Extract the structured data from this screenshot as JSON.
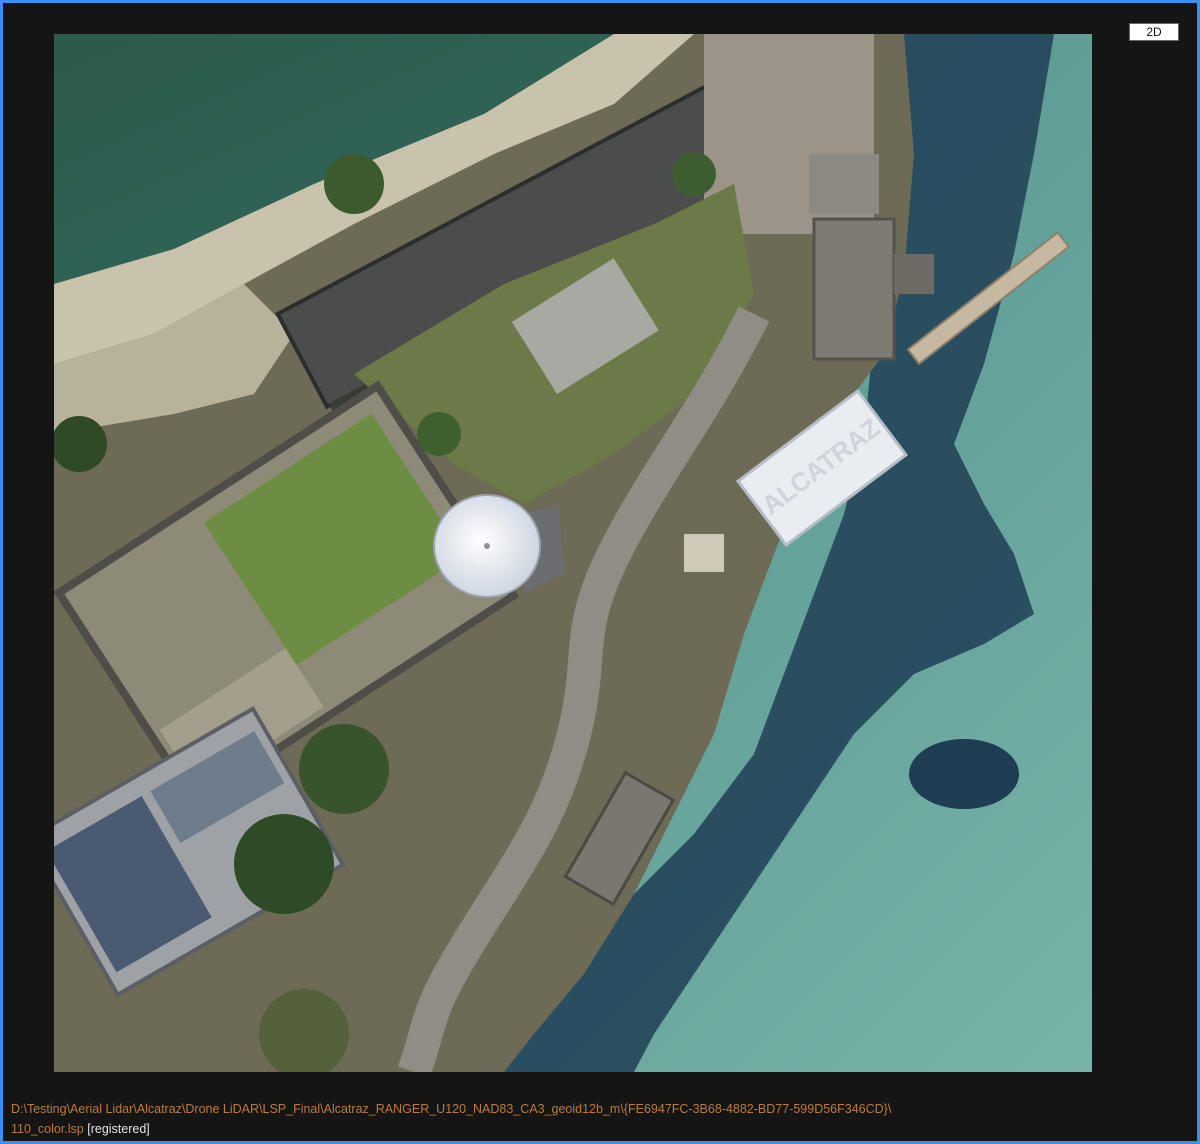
{
  "view": {
    "mode_label": "2D"
  },
  "file": {
    "path_line1": "D:\\Testing\\Aerial Lidar\\Alcatraz\\Drone LiDAR\\LSP_Final\\Alcatraz_RANGER_U120_NAD83_CA3_geoid12b_m\\{FE6947FC-3B68-4882-BD77-599D56F346CD}\\",
    "path_line2": "110_color.lsp",
    "status": "[registered]"
  },
  "image": {
    "subject": "aerial orthophoto of island",
    "roof_lettering": "ALCATRAZ"
  },
  "colors": {
    "frame_border": "#3d8ef0",
    "path_text": "#c07a36",
    "status_text": "#e2e2e2",
    "water_dark": "#2d5f52",
    "water_light": "#6fa9a1"
  }
}
